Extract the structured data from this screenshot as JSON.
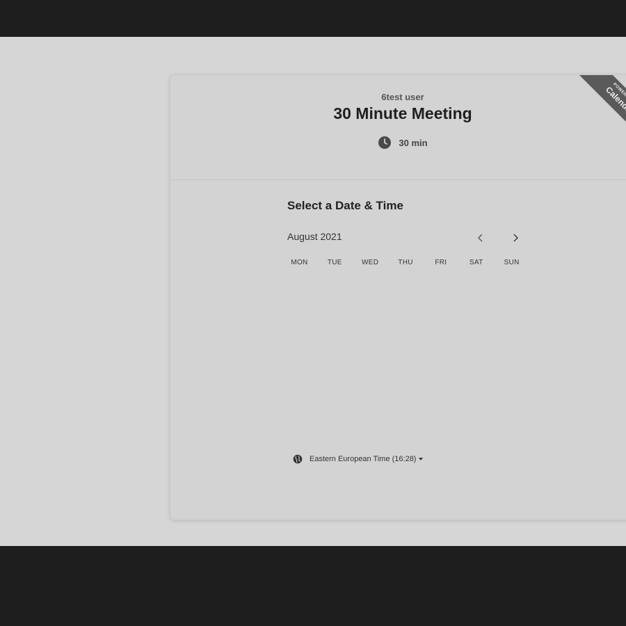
{
  "event": {
    "organizer": "6test user",
    "title": "30 Minute Meeting",
    "duration": "30 min"
  },
  "ribbon": {
    "top_text": "POWERED BY",
    "brand": "Calendly"
  },
  "scheduler": {
    "title": "Select a Date & Time",
    "month": "August 2021",
    "weekdays": [
      "MON",
      "TUE",
      "WED",
      "THU",
      "FRI",
      "SAT",
      "SUN"
    ],
    "timezone": "Eastern European Time (16:28)"
  },
  "icons": {
    "clock": "clock-icon",
    "prev": "chevron-left-icon",
    "next": "chevron-right-icon",
    "globe": "globe-icon",
    "caret": "caret-down-icon"
  },
  "colors": {
    "page_bg": "#d6d6d6",
    "frame_bg": "#1e1e1e",
    "ribbon_bg": "#5a5a5a"
  }
}
